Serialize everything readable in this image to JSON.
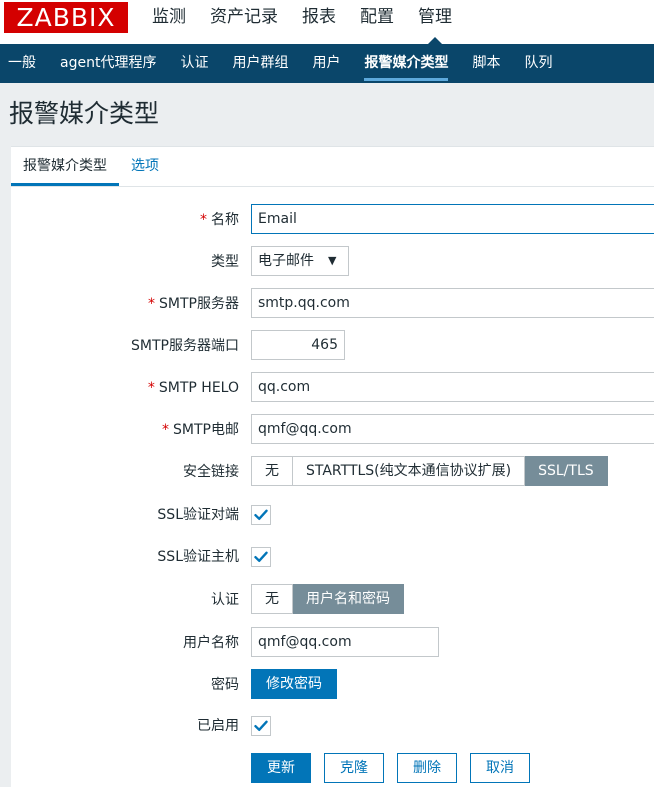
{
  "logo": "ZABBIX",
  "main_menu": [
    "监测",
    "资产记录",
    "报表",
    "配置",
    "管理"
  ],
  "main_menu_active": "管理",
  "sub_menu": [
    "一般",
    "agent代理程序",
    "认证",
    "用户群组",
    "用户",
    "报警媒介类型",
    "脚本",
    "队列"
  ],
  "sub_menu_active": "报警媒介类型",
  "page_title": "报警媒介类型",
  "tabs": [
    "报警媒介类型",
    "选项"
  ],
  "required_marker": "*",
  "form": {
    "name": {
      "label": "名称",
      "value": "Email"
    },
    "type": {
      "label": "类型",
      "value": "电子邮件"
    },
    "smtp_server": {
      "label": "SMTP服务器",
      "value": "smtp.qq.com"
    },
    "smtp_port": {
      "label": "SMTP服务器端口",
      "value": "465"
    },
    "smtp_helo": {
      "label": "SMTP HELO",
      "value": "qq.com"
    },
    "smtp_email": {
      "label": "SMTP电邮",
      "value": "qmf@qq.com"
    },
    "security": {
      "label": "安全链接",
      "options": [
        "无",
        "STARTTLS(纯文本通信协议扩展)",
        "SSL/TLS"
      ],
      "selected": "SSL/TLS"
    },
    "ssl_verify_peer": {
      "label": "SSL验证对端",
      "checked": true
    },
    "ssl_verify_host": {
      "label": "SSL验证主机",
      "checked": true
    },
    "auth": {
      "label": "认证",
      "options": [
        "无",
        "用户名和密码"
      ],
      "selected": "用户名和密码"
    },
    "username": {
      "label": "用户名称",
      "value": "qmf@qq.com"
    },
    "password": {
      "label": "密码",
      "button": "修改密码"
    },
    "enabled": {
      "label": "已启用",
      "checked": true
    }
  },
  "buttons": {
    "update": "更新",
    "clone": "克隆",
    "delete": "删除",
    "cancel": "取消"
  },
  "colors": {
    "brand": "#d40000",
    "nav": "#0a466a",
    "accent": "#0275b8",
    "segment_selected": "#768d99"
  },
  "icons": {
    "checkbox": "check-icon",
    "select": "caret-down-icon"
  }
}
